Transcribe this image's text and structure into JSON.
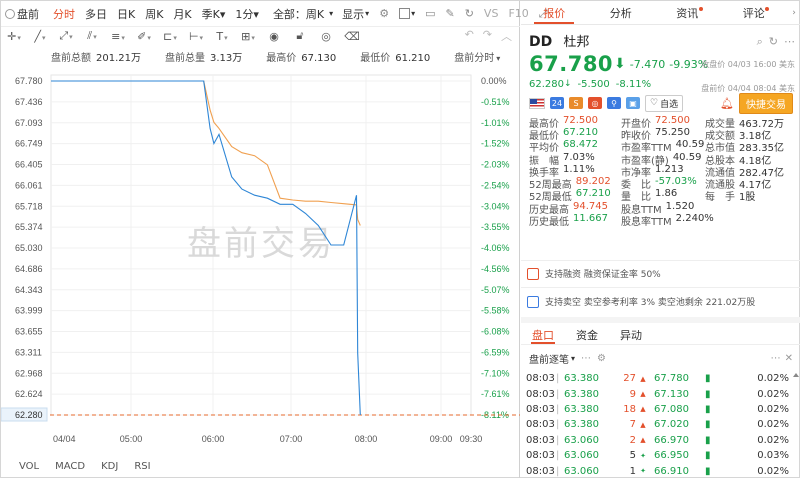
{
  "toolbar": {
    "left_items": [
      {
        "label": "盘前",
        "active": false
      },
      {
        "label": "分时",
        "active": true
      },
      {
        "label": "多日",
        "active": false
      },
      {
        "label": "日K",
        "active": false
      },
      {
        "label": "周K",
        "active": false
      },
      {
        "label": "月K",
        "active": false
      },
      {
        "label": "季K▾",
        "active": false
      },
      {
        "label": "1分▾",
        "active": false
      }
    ],
    "period_select": "全部：周K",
    "display_select": "显示",
    "vs_label": "VS",
    "f10_label": "F10"
  },
  "drawing_tools": [
    "crosshair-icon",
    "line-tool-icon",
    "ray-tool-icon",
    "channel-tool-icon",
    "fib-tool-icon",
    "pen-tool-icon",
    "text-tool-icon",
    "shape-tool-icon",
    "ruler-tool-icon",
    "measure-tool-icon",
    "eye-icon",
    "lock-icon",
    "magnet-icon",
    "visible-icon",
    "delete-icon",
    "more-icon"
  ],
  "stats": {
    "premarket_amount_label": "盘前总额",
    "premarket_amount": "201.21万",
    "premarket_volume_label": "盘前总量",
    "premarket_volume": "3.13万",
    "high_label": "最高价",
    "high": "67.130",
    "low_label": "最低价",
    "low": "61.210",
    "mode_label": "盘前分时"
  },
  "chart": {
    "watermark": "盘前交易",
    "y_labels": [
      "67.780",
      "67.436",
      "67.093",
      "66.749",
      "66.405",
      "66.061",
      "65.718",
      "65.374",
      "65.030",
      "64.686",
      "64.343",
      "63.999",
      "63.655",
      "63.311",
      "62.968",
      "62.624",
      "62.280"
    ],
    "pct_labels": [
      "0.00%",
      "-0.51%",
      "-1.01%",
      "-1.52%",
      "-2.03%",
      "-2.54%",
      "-3.04%",
      "-3.55%",
      "-4.06%",
      "-4.56%",
      "-5.07%",
      "-5.58%",
      "-6.08%",
      "-6.59%",
      "-7.10%",
      "-7.61%",
      "-8.11%"
    ],
    "x_labels": [
      "04/04",
      "05:00",
      "06:00",
      "07:00",
      "08:00",
      "09:00",
      "09:30"
    ],
    "indicators": [
      "VOL",
      "MACD",
      "KDJ",
      "RSI"
    ],
    "colors": {
      "price_line": "#2e86d6",
      "avg_line": "#f0a050",
      "baseline": "#e46a2c",
      "up": "#e3502c",
      "down": "#19a04a"
    }
  },
  "chart_data": {
    "type": "line",
    "x": [
      "04:00",
      "06:00",
      "06:05",
      "06:08",
      "06:12",
      "06:22",
      "06:30",
      "06:40",
      "06:50",
      "07:00",
      "07:10",
      "07:20",
      "07:30",
      "07:40",
      "07:50",
      "08:00",
      "08:01",
      "08:03"
    ],
    "series": [
      {
        "values": [
          67.78,
          67.78,
          67.0,
          66.75,
          66.9,
          66.2,
          66.0,
          65.9,
          65.85,
          65.75,
          65.75,
          65.6,
          65.4,
          65.08,
          65.08,
          65.9,
          63.3,
          62.28
        ]
      },
      {
        "values": [
          67.78,
          67.78,
          67.3,
          67.1,
          67.0,
          66.7,
          66.6,
          66.55,
          66.4,
          65.85,
          65.82,
          65.8,
          65.8,
          65.78,
          65.76,
          65.74,
          65.5,
          65.4
        ]
      }
    ],
    "ylim": [
      62.28,
      67.78
    ],
    "reference_line": 62.28
  },
  "right_tabs": [
    {
      "label": "报价",
      "active": true,
      "dot": false
    },
    {
      "label": "分析",
      "active": false,
      "dot": false
    },
    {
      "label": "资讯",
      "active": false,
      "dot": true
    },
    {
      "label": "评论",
      "active": false,
      "dot": true
    }
  ],
  "quote": {
    "symbol": "DD",
    "name": "杜邦",
    "price": "67.780",
    "change": "-7.470",
    "change_pct": "-9.93%",
    "close_time": "收盘价 04/03 16:00 美东",
    "pre_price": "62.280",
    "pre_change": "-5.500",
    "pre_change_pct": "-8.11%",
    "pre_time": "盘前价 04/04 08:04 美东",
    "badge_24": "24",
    "watch_label": "自选",
    "trade_button": "快捷交易"
  },
  "metrics": [
    [
      {
        "k": "最高价",
        "v": "72.500",
        "c": "up"
      },
      {
        "k": "开盘价",
        "v": "72.500",
        "c": "up"
      },
      {
        "k": "成交量",
        "v": "463.72万",
        "c": ""
      }
    ],
    [
      {
        "k": "最低价",
        "v": "67.210",
        "c": "dn"
      },
      {
        "k": "昨收价",
        "v": "75.250",
        "c": ""
      },
      {
        "k": "成交额",
        "v": "3.18亿",
        "c": ""
      }
    ],
    [
      {
        "k": "平均价",
        "v": "68.472",
        "c": "dn"
      },
      {
        "k": "市盈率TTM",
        "v": "40.59",
        "c": ""
      },
      {
        "k": "总市值",
        "v": "283.35亿",
        "c": ""
      }
    ],
    [
      {
        "k": "振　幅",
        "v": "7.03%",
        "c": ""
      },
      {
        "k": "市盈率(静)",
        "v": "40.59",
        "c": ""
      },
      {
        "k": "总股本",
        "v": "4.18亿",
        "c": ""
      }
    ],
    [
      {
        "k": "换手率",
        "v": "1.11%",
        "c": ""
      },
      {
        "k": "市净率",
        "v": "1.213",
        "c": ""
      },
      {
        "k": "流通值",
        "v": "282.47亿",
        "c": ""
      }
    ],
    [
      {
        "k": "52周最高",
        "v": "89.202",
        "c": "up"
      },
      {
        "k": "委　比",
        "v": "-57.03%",
        "c": "dn"
      },
      {
        "k": "流通股",
        "v": "4.17亿",
        "c": ""
      }
    ],
    [
      {
        "k": "52周最低",
        "v": "67.210",
        "c": "dn"
      },
      {
        "k": "量　比",
        "v": "1.86",
        "c": ""
      },
      {
        "k": "每　手",
        "v": "1股",
        "c": ""
      }
    ],
    [
      {
        "k": "历史最高",
        "v": "94.745",
        "c": "up"
      },
      {
        "k": "股息TTM",
        "v": "1.520",
        "c": ""
      },
      {
        "k": "",
        "v": "",
        "c": ""
      }
    ],
    [
      {
        "k": "历史最低",
        "v": "11.667",
        "c": "dn"
      },
      {
        "k": "股息率TTM",
        "v": "2.240%",
        "c": ""
      },
      {
        "k": "",
        "v": "",
        "c": ""
      }
    ]
  ],
  "notes": {
    "margin": "支持融资  融资保证金率 50%",
    "short": "支持卖空  卖空参考利率 3%  卖空池剩余 221.02万股"
  },
  "bottom_tabs": [
    {
      "label": "盘口",
      "active": true
    },
    {
      "label": "资金",
      "active": false
    },
    {
      "label": "异动",
      "active": false
    }
  ],
  "ticks_header": "盘前逐笔",
  "ticks": [
    {
      "t": "08:03",
      "p": "63.380",
      "q": "27",
      "dir": "up",
      "p2": "67.780",
      "pct": "0.02%"
    },
    {
      "t": "08:03",
      "p": "63.380",
      "q": "9",
      "dir": "up",
      "p2": "67.130",
      "pct": "0.02%"
    },
    {
      "t": "08:03",
      "p": "63.380",
      "q": "18",
      "dir": "up",
      "p2": "67.080",
      "pct": "0.02%"
    },
    {
      "t": "08:03",
      "p": "63.380",
      "q": "7",
      "dir": "up",
      "p2": "67.020",
      "pct": "0.02%"
    },
    {
      "t": "08:03",
      "p": "63.060",
      "q": "2",
      "dir": "up",
      "p2": "66.970",
      "pct": "0.02%"
    },
    {
      "t": "08:03",
      "p": "63.060",
      "q": "5",
      "dir": "dn",
      "p2": "66.950",
      "pct": "0.03%"
    },
    {
      "t": "08:03",
      "p": "63.060",
      "q": "1",
      "dir": "dn",
      "p2": "66.910",
      "pct": "0.02%"
    }
  ]
}
